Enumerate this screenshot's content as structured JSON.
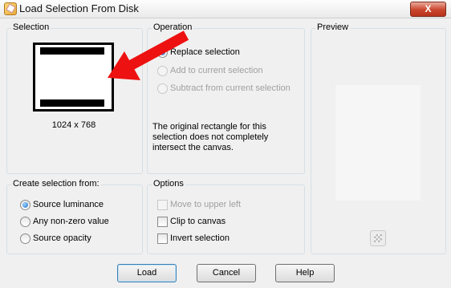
{
  "window": {
    "title": "Load Selection From Disk",
    "close_glyph": "X"
  },
  "selection": {
    "label": "Selection",
    "dimensions": "1024 x 768"
  },
  "operation": {
    "label": "Operation",
    "options": [
      "Replace selection",
      "Add to current selection",
      "Subtract from current selection"
    ],
    "note": "The original rectangle for this selection does not completely intersect the canvas."
  },
  "preview": {
    "label": "Preview"
  },
  "create_from": {
    "label": "Create selection from:",
    "options": [
      "Source luminance",
      "Any non-zero value",
      "Source opacity"
    ]
  },
  "options": {
    "label": "Options",
    "items": [
      "Move to upper left",
      "Clip to canvas",
      "Invert selection"
    ]
  },
  "buttons": {
    "load": "Load",
    "cancel": "Cancel",
    "help": "Help"
  },
  "colors": {
    "arrow": "#ee1111",
    "close": "#c9452c",
    "accent": "#1c6fc6"
  }
}
